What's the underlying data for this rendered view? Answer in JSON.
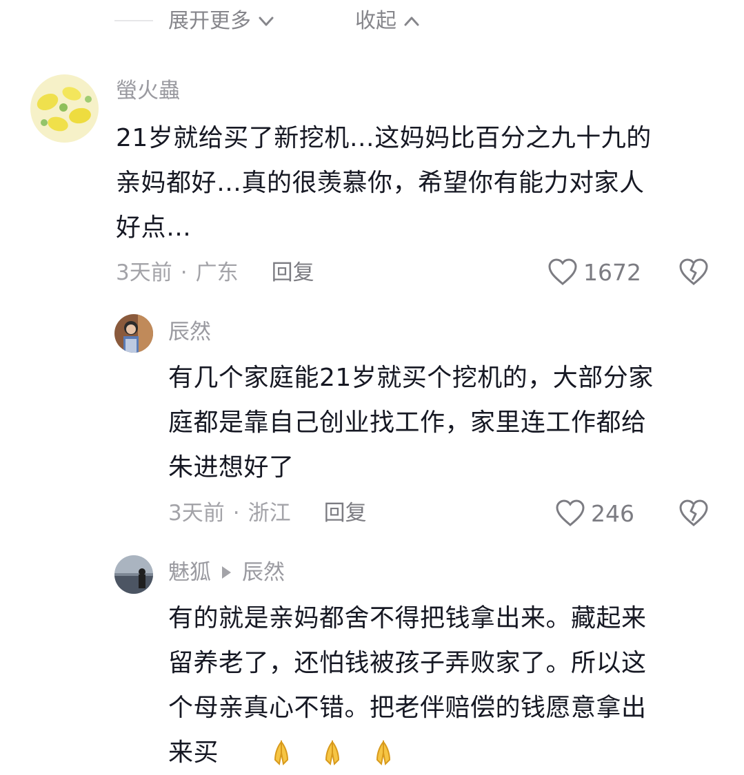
{
  "top_bar": {
    "expand_label": "展开更多",
    "collapse_label": "收起"
  },
  "comments": [
    {
      "username": "螢火蟲",
      "text": "21岁就给买了新挖机…这妈妈比百分之九十九的亲妈都好…真的很羡慕你，希望你有能力对家人好点…",
      "lines": [
        "21岁就给买了新挖机…这妈妈比百分之九十九的",
        "亲妈都好…真的很羡慕你，希望你有能力对家人",
        "好点…"
      ],
      "time": "3天前",
      "location": "广东",
      "reply_label": "回复",
      "likes": "1672"
    },
    {
      "username": "辰然",
      "lines": [
        "有几个家庭能21岁就买个挖机的，大部分家",
        "庭都是靠自己创业找工作，家里连工作都给",
        "朱进想好了"
      ],
      "time": "3天前",
      "location": "浙江",
      "reply_label": "回复",
      "likes": "246"
    },
    {
      "username": "魅狐",
      "reply_to": "辰然",
      "lines": [
        "有的就是亲妈都舍不得把钱拿出来。藏起来",
        "留养老了，还怕钱被孩子弄败家了。所以这",
        "个母亲真心不错。把老伴赔偿的钱愿意拿出",
        "来买"
      ]
    }
  ],
  "separator": "·",
  "colors": {
    "text": "#161823",
    "muted": "#a3a3a8",
    "accent": "#7c7c82"
  }
}
